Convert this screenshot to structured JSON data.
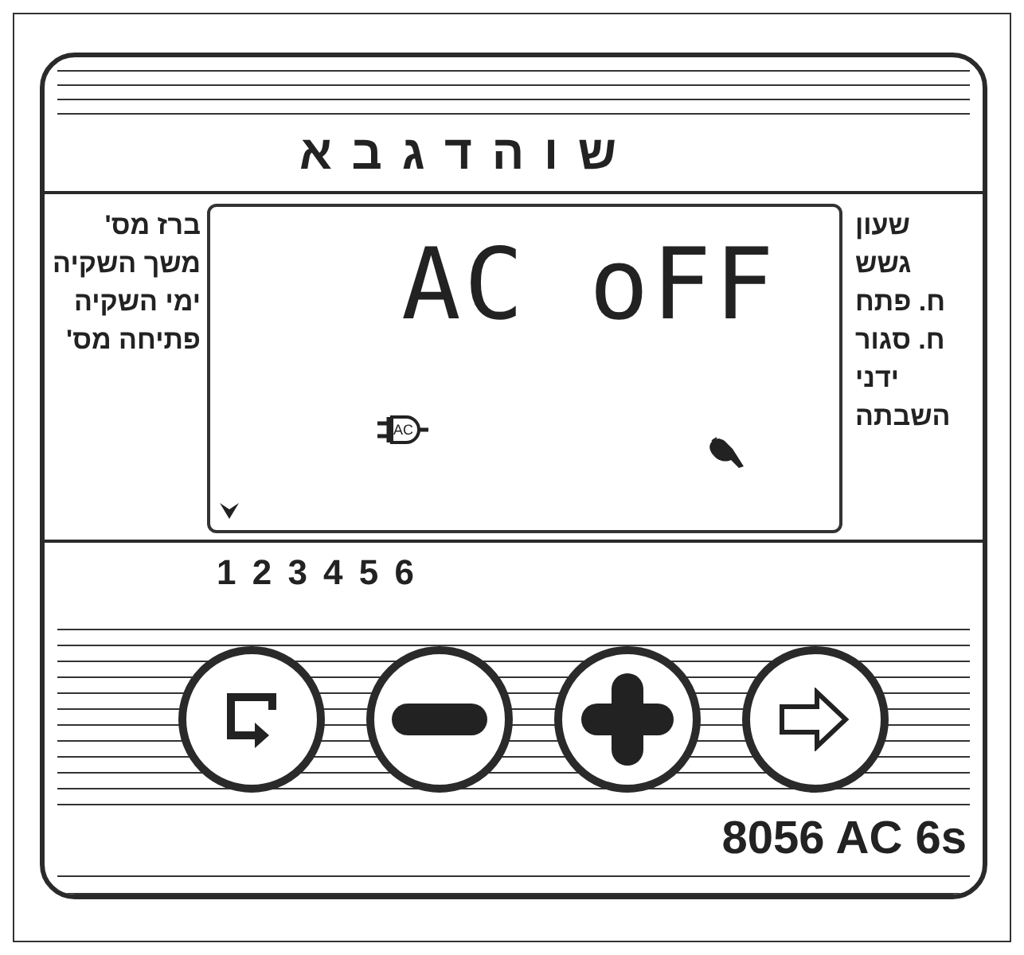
{
  "days": "ש ו ה ד ג ב א",
  "left_labels": [
    "ברז מס'",
    "משך השקיה",
    "ימי השקיה",
    "פתיחה מס'"
  ],
  "display": {
    "text": "AC oFF",
    "plug_label": "AC"
  },
  "right_labels": [
    "שעון",
    "גשש",
    "ח. פתח",
    "ח. סגור",
    "ידני",
    "השבתה"
  ],
  "stations": "1 2 3 4 5 6",
  "buttons": [
    {
      "kind": "return"
    },
    {
      "kind": "minus"
    },
    {
      "kind": "plus"
    },
    {
      "kind": "next"
    }
  ],
  "model": "8056 AC 6s"
}
